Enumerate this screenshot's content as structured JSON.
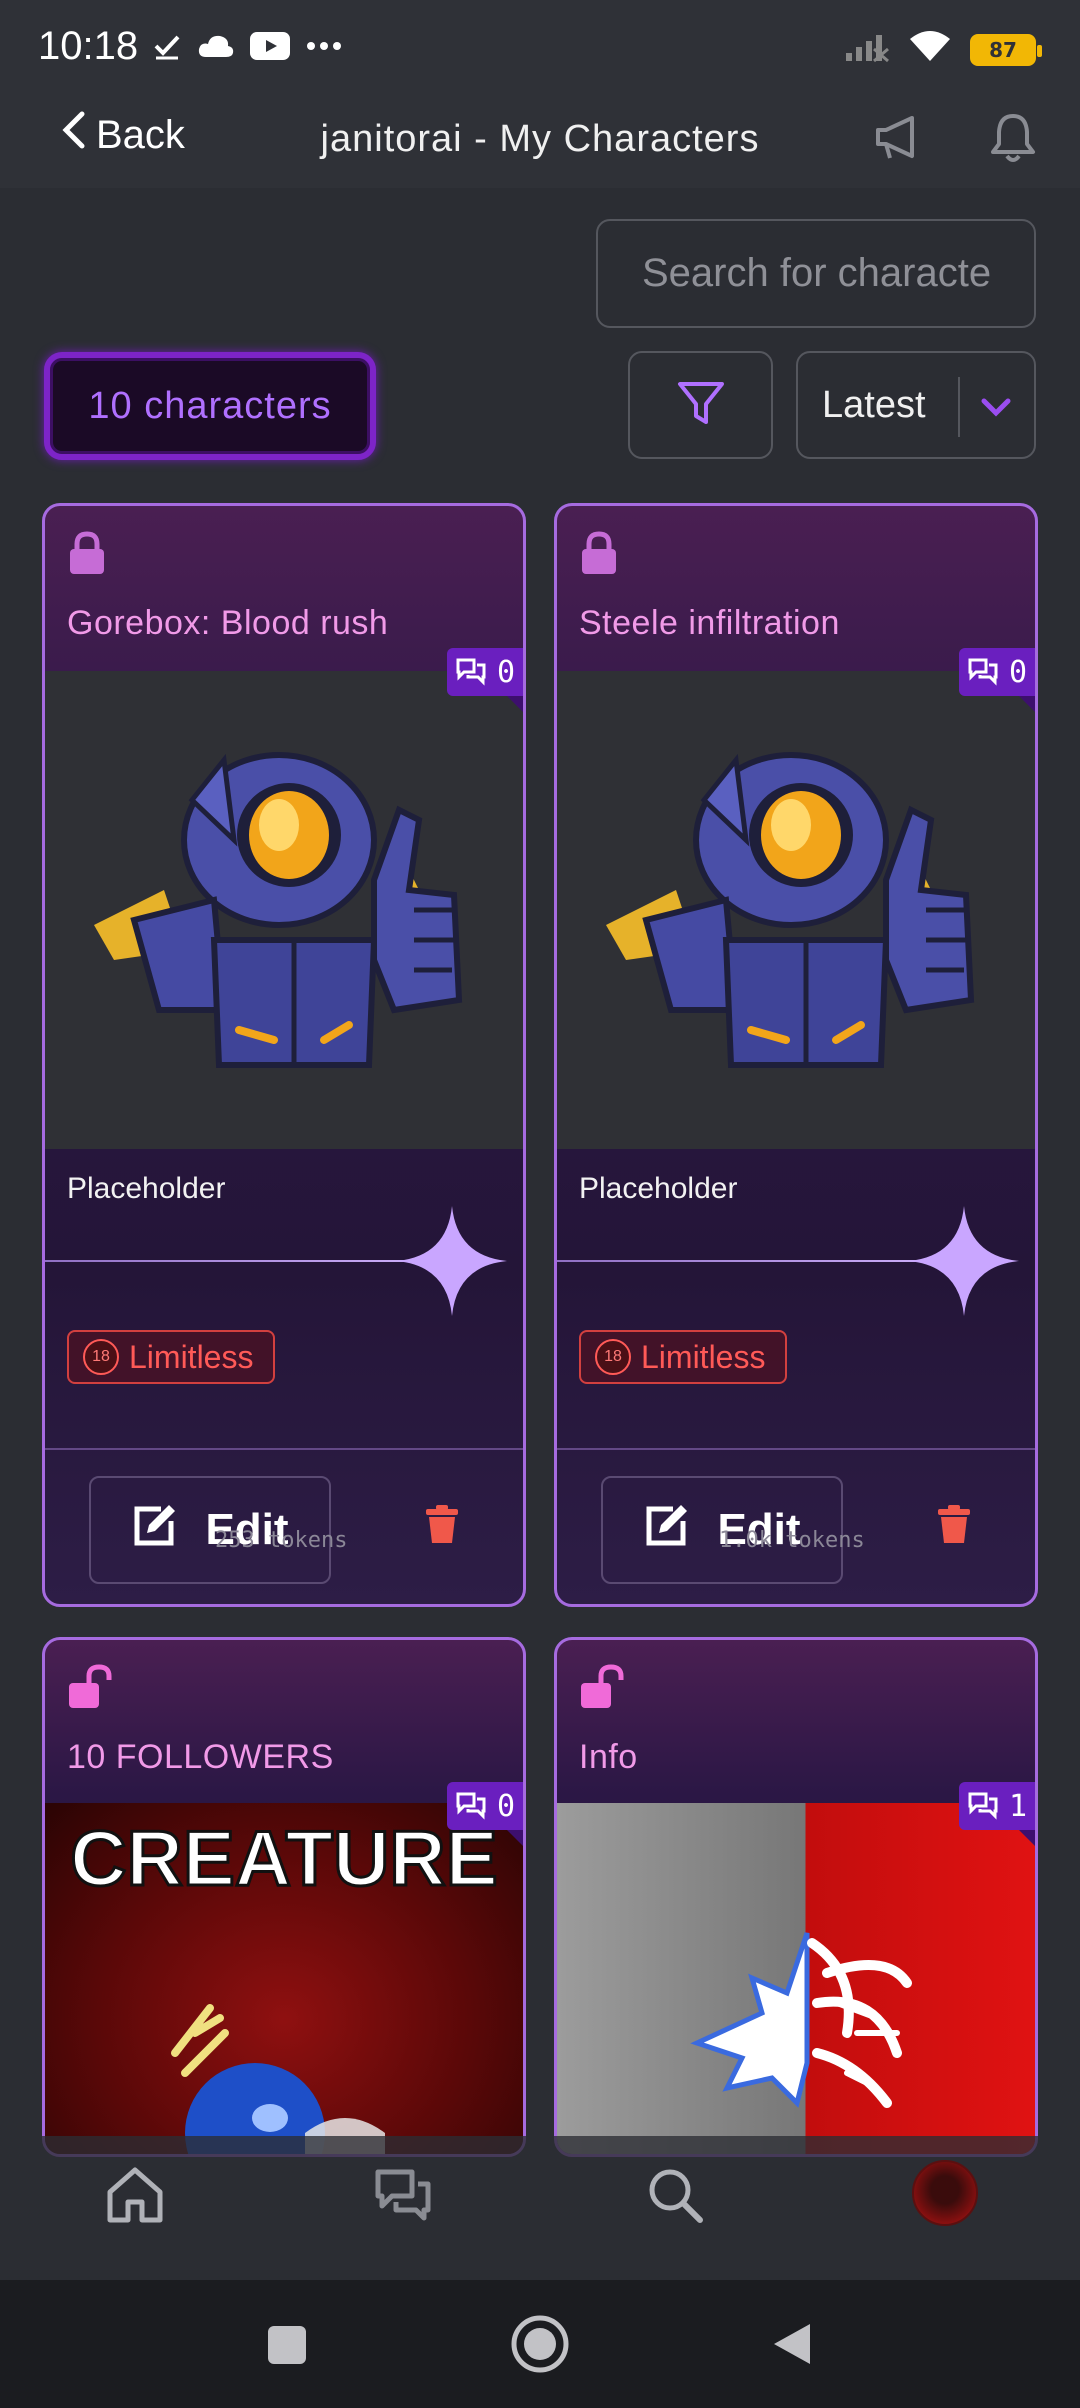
{
  "status_bar": {
    "time": "10:18",
    "battery": "87",
    "icons": [
      "check-icon",
      "cloud-icon",
      "youtube-icon",
      "more-dots-icon",
      "signal-off-icon",
      "wifi-icon",
      "battery-icon"
    ]
  },
  "app_bar": {
    "back_label": "Back",
    "title": "janitorai - My Characters"
  },
  "search": {
    "placeholder": "Search for characters"
  },
  "character_count": "10 characters",
  "sort": {
    "selected": "Latest"
  },
  "cards": [
    {
      "name": "Gorebox: Blood rush",
      "locked": true,
      "chat_count": "0",
      "description": "Placeholder",
      "tag": "Limitless",
      "edit_label": "Edit",
      "tokens": "253 tokens"
    },
    {
      "name": "Steele infiltration",
      "locked": true,
      "chat_count": "0",
      "description": "Placeholder",
      "tag": "Limitless",
      "edit_label": "Edit",
      "tokens": "1.0k tokens"
    },
    {
      "name": "10 FOLLOWERS",
      "locked": false,
      "chat_count": "0",
      "image_text": "CREATURE"
    },
    {
      "name": "Info",
      "locked": false,
      "chat_count": "1"
    }
  ],
  "age_badge": "18",
  "colors": {
    "accent_purple": "#7d24c8",
    "card_border": "#a66be0",
    "name_pink": "#f19ae8",
    "danger_red": "#ff5a57"
  }
}
